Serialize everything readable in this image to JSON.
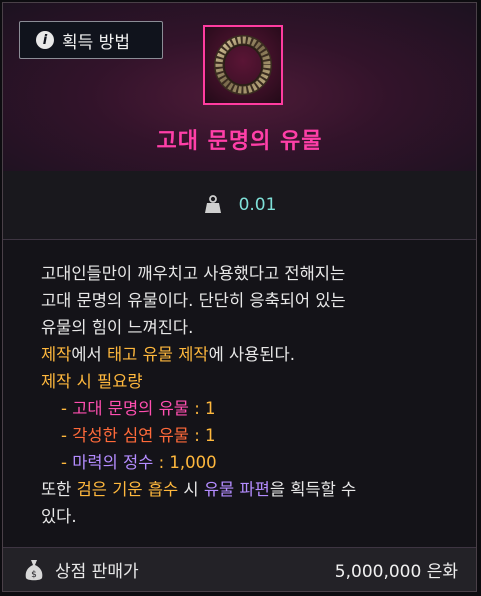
{
  "header": {
    "acquisition_button": "획득 방법",
    "info_icon": "info-icon",
    "item_name": "고대 문명의 유물",
    "item_name_color": "#ff3fa8",
    "item_icon": "ancient-ring-icon"
  },
  "weight": {
    "icon": "weight-icon",
    "value": "0.01"
  },
  "description": {
    "line1": "고대인들만이 깨우치고 사용했다고 전해지는",
    "line2": "고대 문명의 유물이다. 단단히 응축되어 있는",
    "line3": "유물의 힘이 느껴진다.",
    "craft_word": "제작",
    "craft_mid": "에서 ",
    "craft_target": "태고 유물 제작",
    "craft_end": "에 사용된다.",
    "requirement_title": "제작 시 필요량",
    "materials": [
      {
        "dash": "- ",
        "name": "고대 문명의 유물",
        "sep": " : ",
        "qty": "1"
      },
      {
        "dash": "- ",
        "name": "각성한 심연 유물",
        "sep": " : ",
        "qty": "1"
      },
      {
        "dash": "- ",
        "name": "마력의 정수",
        "sep": " : ",
        "qty": "1,000"
      }
    ],
    "extra_start": "또한 ",
    "extra_absorb": "검은 기운 흡수",
    "extra_mid": " 시 ",
    "extra_fragment": "유물 파편",
    "extra_end1": "을 획득할 수",
    "extra_end2": "있다."
  },
  "footer": {
    "icon": "money-bag-icon",
    "label": "상점 판매가",
    "price": "5,000,000 은화"
  },
  "colors": {
    "accent_pink": "#ff3fa8",
    "orange": "#ffb83d",
    "red": "#ff6a3a",
    "violet": "#b48cff",
    "weight_teal": "#7fe0d8"
  }
}
